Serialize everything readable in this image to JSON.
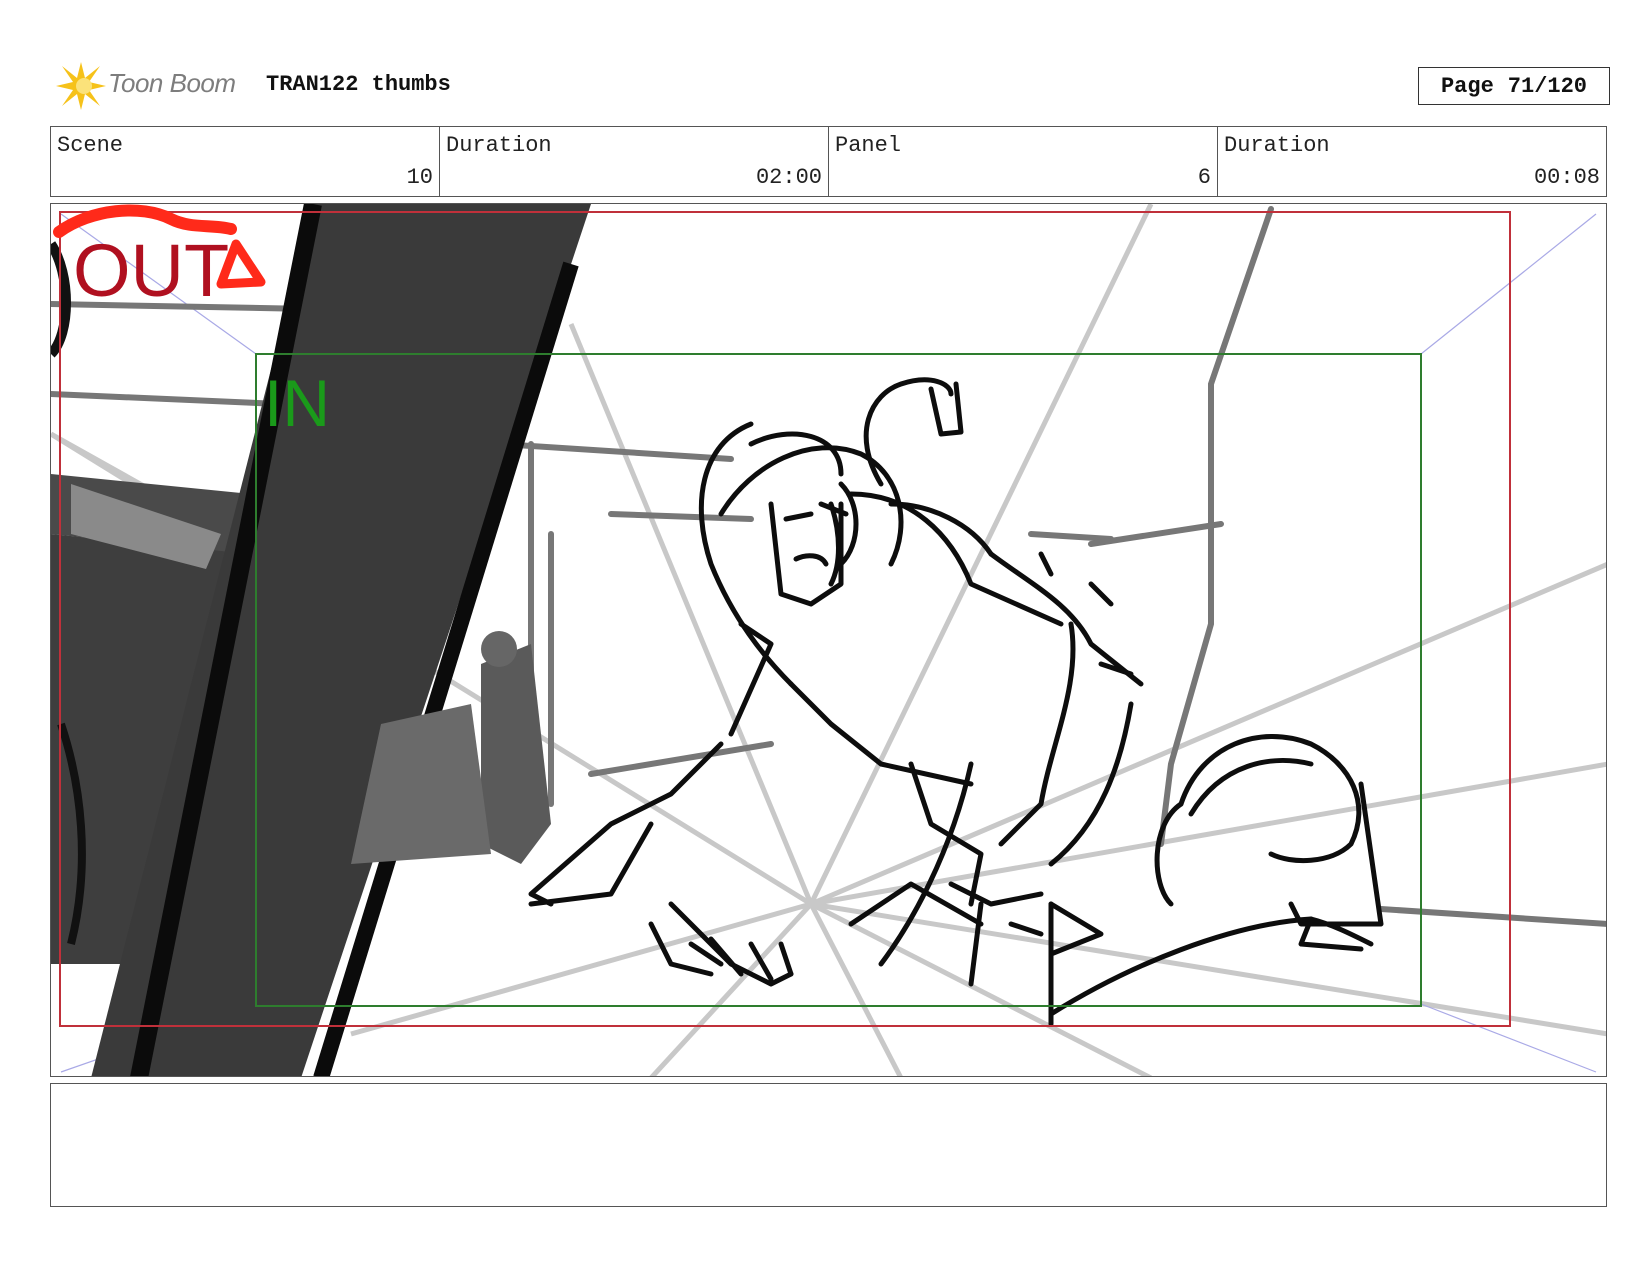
{
  "header": {
    "logo_text": "Toon Boom",
    "document_title": "TRAN122 thumbs",
    "page_label": "Page",
    "page_value": "71/120"
  },
  "info": {
    "scene_label": "Scene",
    "scene_value": "10",
    "scene_duration_label": "Duration",
    "scene_duration_value": "02:00",
    "panel_label": "Panel",
    "panel_value": "6",
    "panel_duration_label": "Duration",
    "panel_duration_value": "00:08"
  },
  "panel_marks": {
    "out_label": "OUT",
    "in_label": "IN",
    "out_color": "#b01020",
    "in_color": "#1a9a1a",
    "out_frame_color": "#c0303a",
    "in_frame_color": "#2e7d2e"
  },
  "notes": {
    "text": ""
  }
}
